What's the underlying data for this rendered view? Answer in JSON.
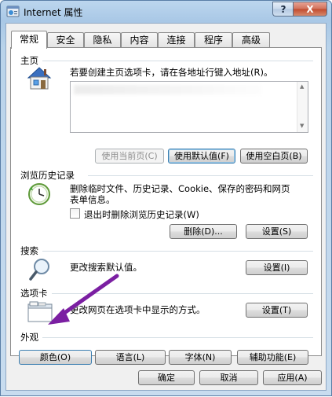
{
  "window": {
    "title": "Internet 属性",
    "help_label": "?",
    "close_label": "X"
  },
  "tabs": [
    {
      "label": "常规",
      "active": true
    },
    {
      "label": "安全",
      "active": false
    },
    {
      "label": "隐私",
      "active": false
    },
    {
      "label": "内容",
      "active": false
    },
    {
      "label": "连接",
      "active": false
    },
    {
      "label": "程序",
      "active": false
    },
    {
      "label": "高级",
      "active": false
    }
  ],
  "homepage": {
    "title": "主页",
    "description": "若要创建主页选项卡，请在各地址行键入地址(R)。",
    "buttons": {
      "use_current": "使用当前页(C)",
      "use_default": "使用默认值(F)",
      "use_blank": "使用空白页(B)"
    }
  },
  "history": {
    "title": "浏览历史记录",
    "description_line1": "删除临时文件、历史记录、Cookie、保存的密码和网页",
    "description_line2": "表单信息。",
    "checkbox_label": "退出时删除浏览历史记录(W)",
    "checkbox_checked": false,
    "buttons": {
      "delete": "删除(D)...",
      "settings": "设置(S)"
    }
  },
  "search": {
    "title": "搜索",
    "description": "更改搜索默认值。",
    "buttons": {
      "settings": "设置(I)"
    }
  },
  "tabs_section": {
    "title": "选项卡",
    "description": "更改网页在选项卡中显示的方式。",
    "buttons": {
      "settings": "设置(T)"
    }
  },
  "appearance": {
    "title": "外观",
    "buttons": {
      "colors": "颜色(O)",
      "languages": "语言(L)",
      "fonts": "字体(N)",
      "accessibility": "辅助功能(E)"
    }
  },
  "footer": {
    "ok": "确定",
    "cancel": "取消",
    "apply": "应用(A)"
  },
  "colors": {
    "annotation_arrow": "#7b1fa2",
    "default_button_border": "#3c7fb1"
  }
}
